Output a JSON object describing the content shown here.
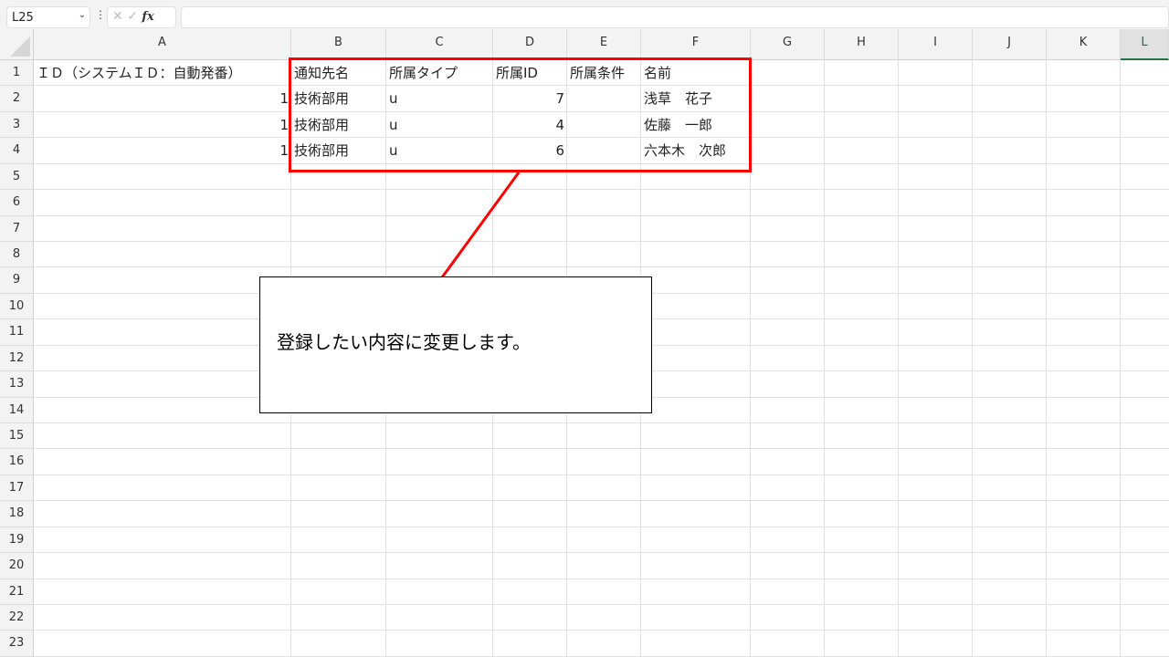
{
  "formula_bar": {
    "name_box": "L25",
    "fx_label": "fx",
    "formula": ""
  },
  "columns": [
    "A",
    "B",
    "C",
    "D",
    "E",
    "F",
    "G",
    "H",
    "I",
    "J",
    "K",
    "L"
  ],
  "selected_column": "L",
  "rows": [
    "1",
    "2",
    "3",
    "4",
    "5",
    "6",
    "7",
    "8",
    "9",
    "10",
    "11",
    "12",
    "13",
    "14",
    "15",
    "16",
    "17",
    "18",
    "19",
    "20",
    "21",
    "22",
    "23"
  ],
  "cells": {
    "header": [
      "ＩＤ（システムＩＤ：自動発番）",
      "通知先名",
      "所属タイプ",
      "所属ID",
      "所属条件",
      "名前"
    ],
    "data": [
      [
        "1",
        "技術部用",
        "u",
        "7",
        "",
        "浅草　花子"
      ],
      [
        "1",
        "技術部用",
        "u",
        "4",
        "",
        "佐藤　一郎"
      ],
      [
        "1",
        "技術部用",
        "u",
        "6",
        "",
        "六本木　次郎"
      ]
    ]
  },
  "annotation": {
    "text": "登録したい内容に変更します。",
    "highlight_color": "#ff0000"
  }
}
